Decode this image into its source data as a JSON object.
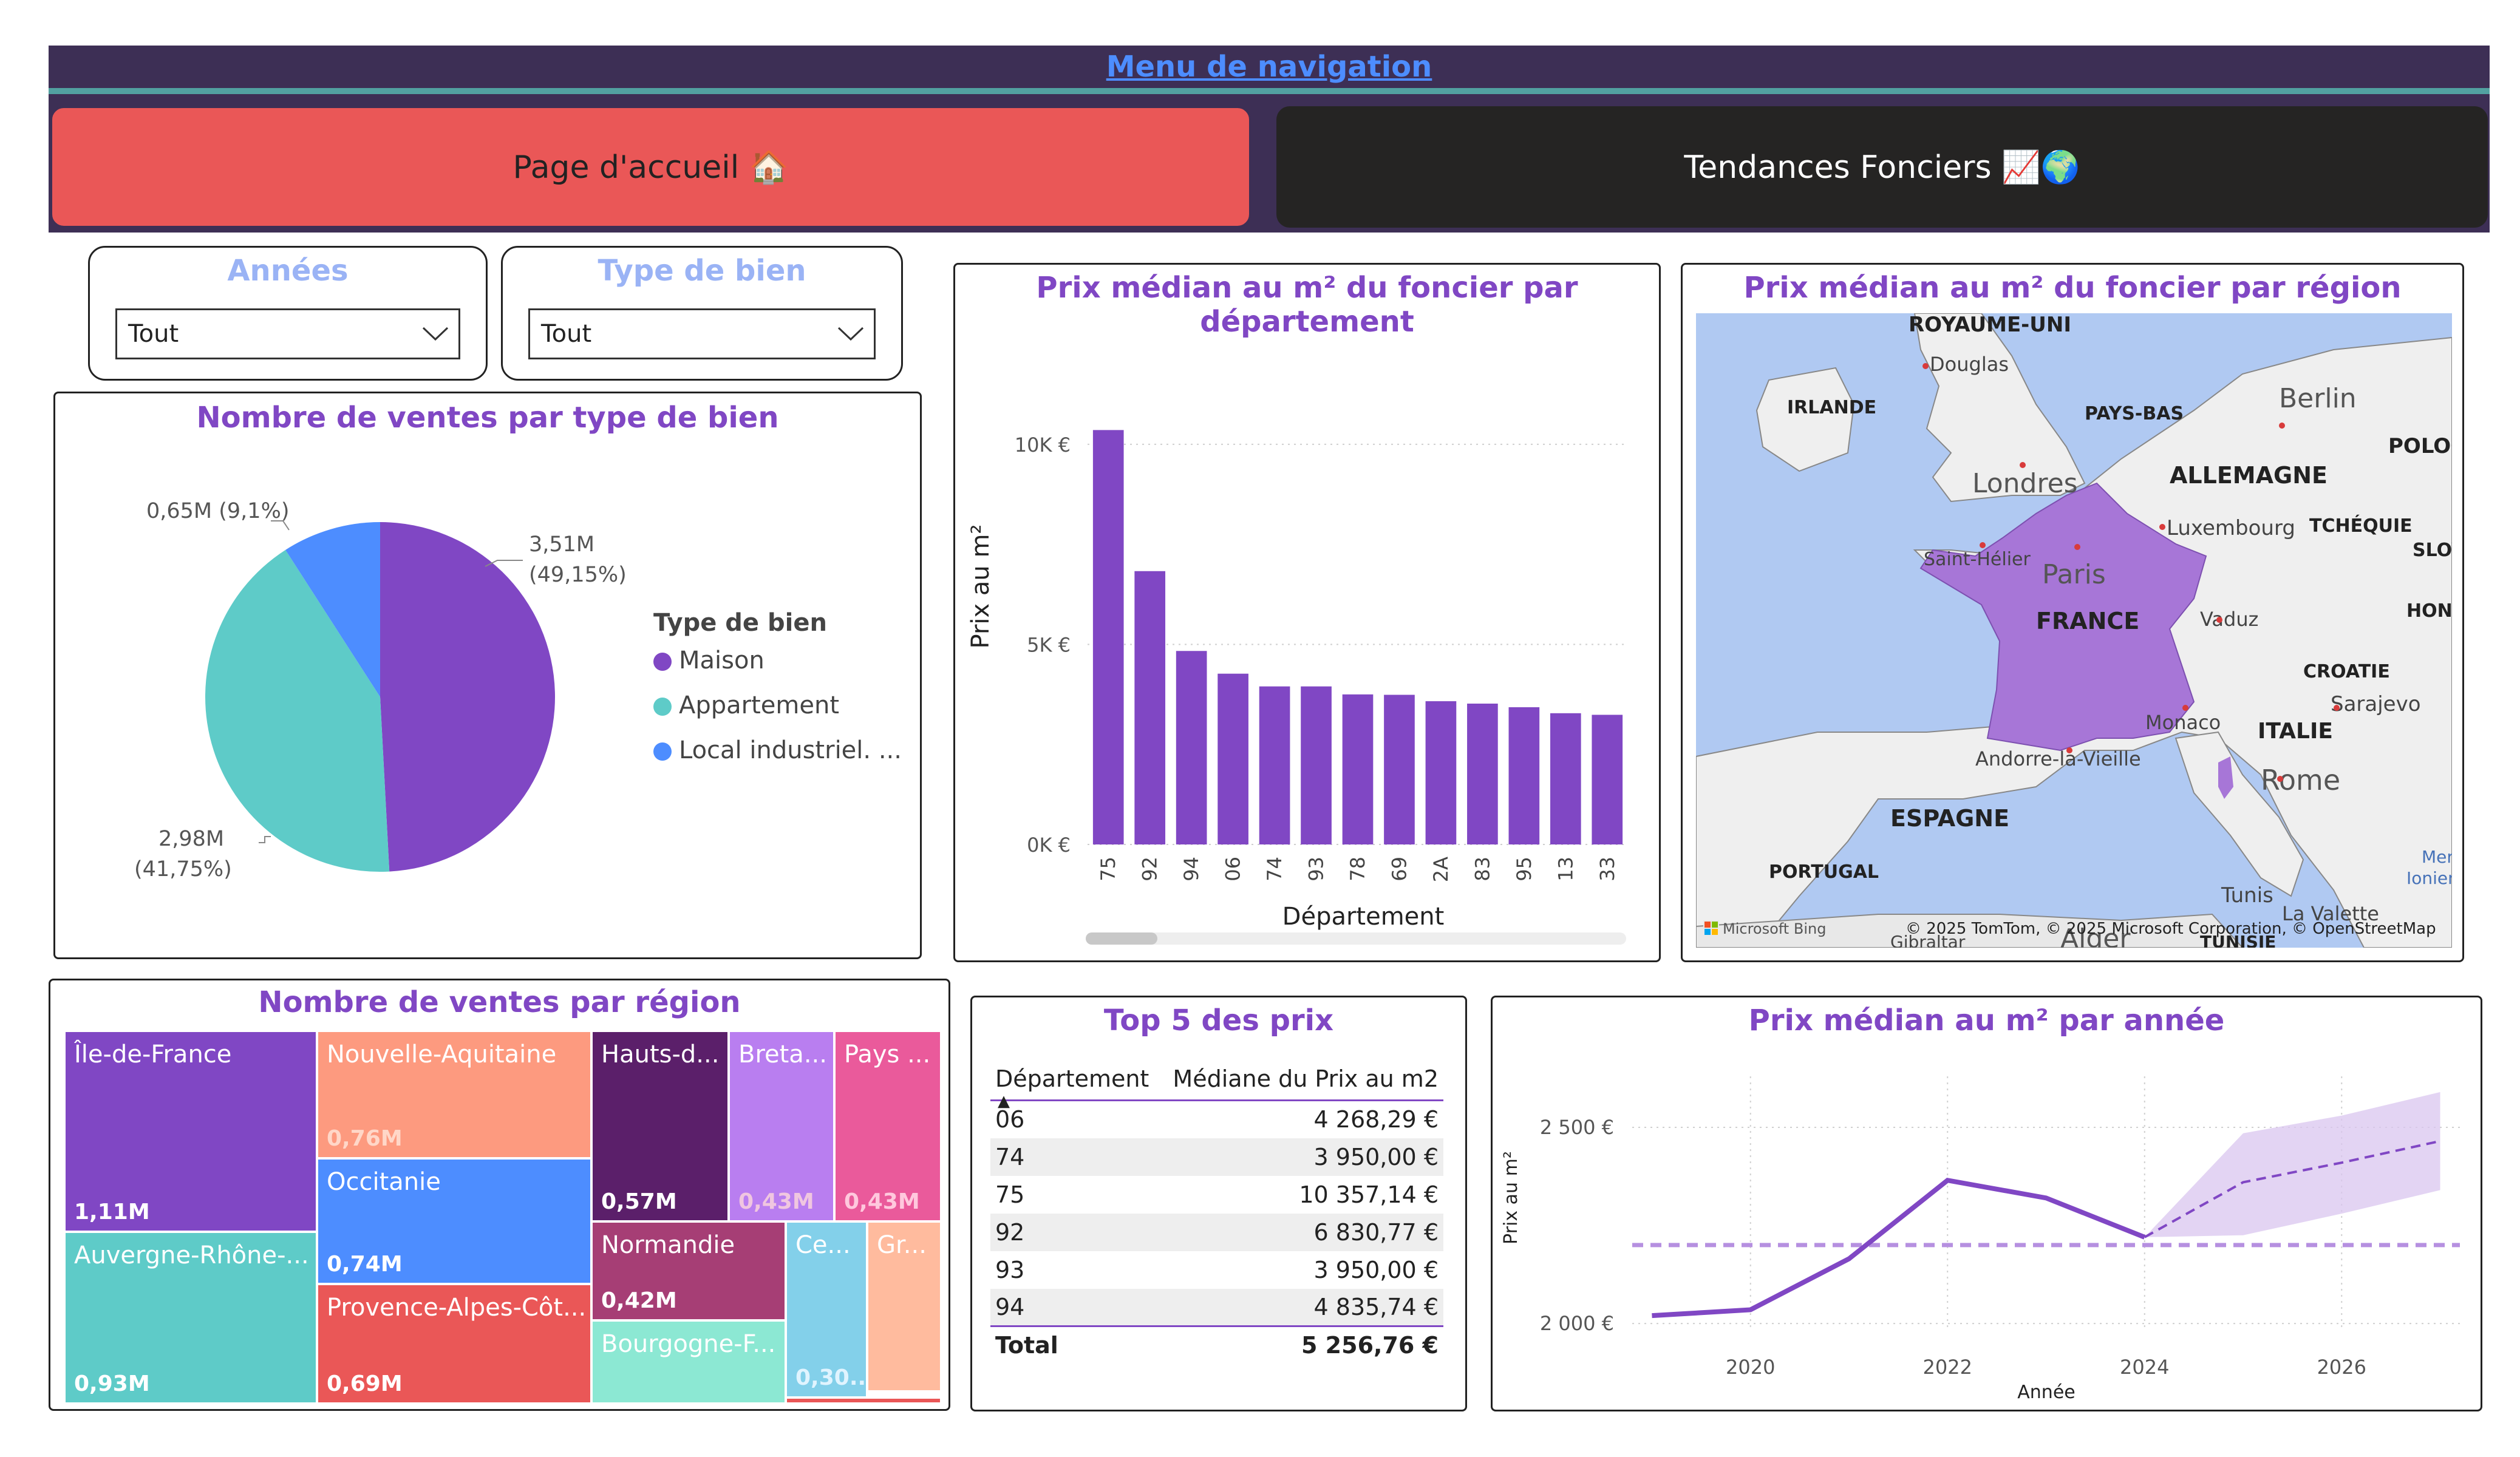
{
  "nav": {
    "menu_label": "Menu de navigation",
    "home_label": "Page d'accueil 🏠",
    "trends_label": "Tendances Fonciers 📈🌍",
    "colors": {
      "bar": "#3d2f55",
      "home": "#ea5757",
      "trends": "#252423",
      "link": "#4d8dff"
    }
  },
  "slicers": {
    "years": {
      "title": "Années",
      "value": "Tout"
    },
    "type": {
      "title": "Type de bien",
      "value": "Tout"
    }
  },
  "pie": {
    "title": "Nombre de ventes par type de bien",
    "legend_title": "Type de bien",
    "labels": {
      "maison_value": "3,51M",
      "maison_pct": "(49,15%)",
      "appt_value": "2,98M",
      "appt_pct": "(41,75%)",
      "local": "0,65M (9,1%)"
    },
    "legend": [
      "Maison",
      "Appartement",
      "Local industriel. ..."
    ],
    "chart_data": {
      "type": "pie",
      "series": [
        {
          "name": "Maison",
          "value": 3.51,
          "percent": 49.15,
          "color": "#8047c4"
        },
        {
          "name": "Appartement",
          "value": 2.98,
          "percent": 41.75,
          "color": "#5ecbc8"
        },
        {
          "name": "Local industriel. ...",
          "value": 0.65,
          "percent": 9.1,
          "color": "#4d8dff"
        }
      ]
    }
  },
  "bar": {
    "title": "Prix médian au m² du foncier par département",
    "chart_data": {
      "type": "bar",
      "categories": [
        "75",
        "92",
        "94",
        "06",
        "74",
        "93",
        "78",
        "69",
        "2A",
        "83",
        "95",
        "13",
        "33"
      ],
      "values": [
        10357,
        6831,
        4836,
        4268,
        3950,
        3950,
        3750,
        3740,
        3580,
        3520,
        3430,
        3280,
        3240
      ],
      "xlabel": "Département",
      "ylabel": "Prix au m²",
      "ylim": [
        0,
        11000
      ],
      "yticks": [
        "0K €",
        "5K €",
        "10K €"
      ],
      "grid": true,
      "color": "#8047c4"
    }
  },
  "map": {
    "title": "Prix médian au m² du foncier par région",
    "labels": {
      "uk": "ROYAUME-UNI",
      "douglas": "Douglas",
      "irlande": "IRLANDE",
      "paysbas": "PAYS-BAS",
      "berlin": "Berlin",
      "pologne": "POLOG",
      "londres": "Londres",
      "allemagne": "ALLEMAGNE",
      "luxembourg": "Luxembourg",
      "tcheq": "TCHÉQUIE",
      "slova": "SLOVA",
      "sthelier": "Saint-Hélier",
      "paris": "Paris",
      "france": "FRANCE",
      "hong": "HONG",
      "vaduz": "Vaduz",
      "croatie": "CROATIE",
      "sarajevo": "Sarajevo",
      "monaco": "Monaco",
      "italie": "ITALIE",
      "andorre": "Andorre-la-Vieille",
      "rome": "Rome",
      "espagne": "ESPAGNE",
      "portugal": "PORTUGAL",
      "tunis": "Tunis",
      "valette": "La Valette",
      "mer": "Mer",
      "ionienne": "Ionienn",
      "alger": "Alger",
      "gibraltar": "Gibraltar",
      "tunisie": "TUNISIE"
    },
    "copyright": "© 2025 TomTom, © 2025 Microsoft Corporation, © OpenStreetMap",
    "bing": "Microsoft Bing"
  },
  "treemap": {
    "title": "Nombre de ventes par région",
    "tiles": [
      {
        "label": "Île-de-France",
        "value": "1,11M",
        "color": "#8047c4"
      },
      {
        "label": "Auvergne-Rhône-...",
        "value": "0,93M",
        "color": "#5ecbc8"
      },
      {
        "label": "Nouvelle-Aquitaine",
        "value": "0,76M",
        "color": "#fd9a7f"
      },
      {
        "label": "Occitanie",
        "value": "0,74M",
        "color": "#4d8dff"
      },
      {
        "label": "Provence-Alpes-Côt...",
        "value": "0,69M",
        "color": "#ea5757"
      },
      {
        "label": "Hauts-d...",
        "value": "0,57M",
        "color": "#5b1f6a"
      },
      {
        "label": "Breta...",
        "value": "0,43M",
        "color": "#b97ef0"
      },
      {
        "label": "Pays ...",
        "value": "0,43M",
        "color": "#ea5a9b"
      },
      {
        "label": "Normandie",
        "value": "0,42M",
        "color": "#a63e75"
      },
      {
        "label": "Bourgogne-F...",
        "value": "",
        "color": "#8ce8d3"
      },
      {
        "label": "Ce...",
        "value": "0,30...",
        "color": "#83d0ea"
      },
      {
        "label": "Gr...",
        "value": "",
        "color": "#ffbb9e"
      }
    ]
  },
  "top5": {
    "title": "Top 5 des prix",
    "headers": [
      "Département",
      "Médiane du Prix au m2"
    ],
    "rows": [
      [
        "06",
        "4 268,29 €"
      ],
      [
        "74",
        "3 950,00 €"
      ],
      [
        "75",
        "10 357,14 €"
      ],
      [
        "92",
        "6 830,77 €"
      ],
      [
        "93",
        "3 950,00 €"
      ],
      [
        "94",
        "4 835,74 €"
      ]
    ],
    "total_label": "Total",
    "total_value": "5 256,76 €"
  },
  "line": {
    "title": "Prix médian au m² par année",
    "chart_data": {
      "type": "line",
      "x": [
        2019,
        2020,
        2021,
        2022,
        2023,
        2024
      ],
      "values": [
        2020,
        2035,
        2165,
        2365,
        2320,
        2220
      ],
      "forecast": {
        "x": [
          2024,
          2025,
          2026,
          2027
        ],
        "values": [
          2220,
          2360,
          2410,
          2465
        ],
        "upper": [
          2220,
          2485,
          2530,
          2590
        ],
        "lower": [
          2220,
          2225,
          2280,
          2340
        ]
      },
      "reference_line": 2200,
      "xlabel": "Année",
      "ylabel": "Prix au m²",
      "xticks": [
        2020,
        2022,
        2024,
        2026
      ],
      "ytick_values": [
        2000,
        2500
      ],
      "ytick_labels": [
        "2 000 €",
        "2 500 €"
      ],
      "ylim": [
        1980,
        2630
      ],
      "xlim": [
        2018.8,
        2027.2
      ],
      "color": "#8047c4"
    }
  }
}
